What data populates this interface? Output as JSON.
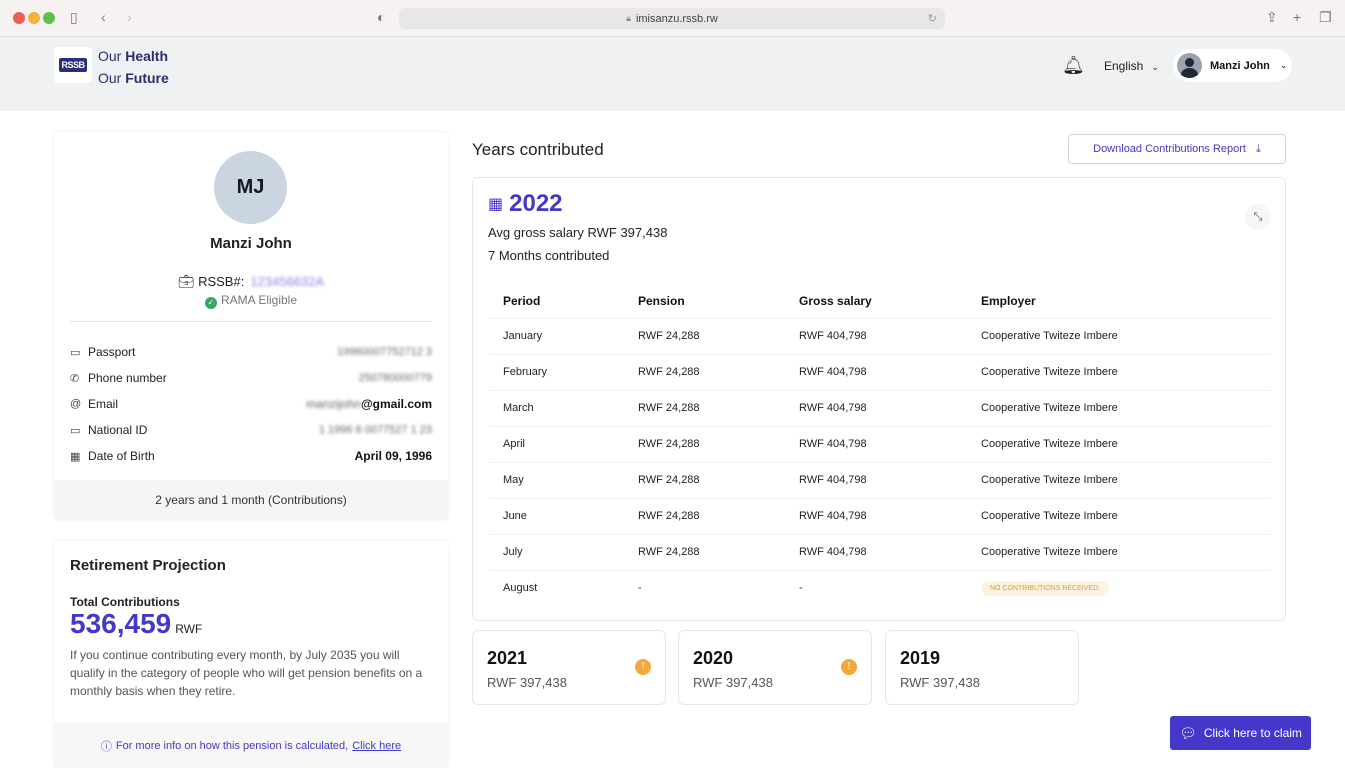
{
  "browser": {
    "url": "imisanzu.rssb.rw"
  },
  "header": {
    "logo_text": "RSSB",
    "tagline_line1_prefix": "Our",
    "tagline_line1_bold": "Health",
    "tagline_line2_prefix": "Our",
    "tagline_line2_bold": "Future",
    "language": "English",
    "user_name": "Manzi John"
  },
  "profile": {
    "initials": "MJ",
    "name": "Manzi John",
    "rssb_label": "RSSB#:",
    "rssb_number": "123456632A",
    "rama_status": "RAMA Eligible",
    "fields": [
      {
        "label": "Passport",
        "value": "19960007752712 3",
        "icon": "id-card-icon",
        "blurred": true
      },
      {
        "label": "Phone number",
        "value": "250780000779",
        "icon": "phone-icon",
        "blurred": true
      },
      {
        "label": "Email",
        "value_blur": "manzijohn",
        "value": "@gmail.com",
        "icon": "at-icon"
      },
      {
        "label": "National ID",
        "value": "1 1996 8 0077527 1 23",
        "icon": "id-card-icon",
        "blurred": true
      },
      {
        "label": "Date of Birth",
        "value": "April 09, 1996",
        "icon": "calendar-icon"
      }
    ],
    "contribution_duration": "2 years and 1 month (Contributions)"
  },
  "retirement": {
    "title": "Retirement Projection",
    "total_label": "Total Contributions",
    "total_value": "536,459",
    "currency": "RWF",
    "description": "If you continue contributing every month, by July 2035 you will qualify in the category of people who will get pension benefits on a monthly basis when they retire.",
    "info_text": "For more info on how this pension is calculated,",
    "info_link": "Click here"
  },
  "years": {
    "title": "Years contributed",
    "download_label": "Download Contributions Report",
    "current": {
      "year": "2022",
      "avg_salary": "Avg gross salary RWF 397,438",
      "months": "7 Months contributed",
      "columns": [
        "Period",
        "Pension",
        "Gross salary",
        "Employer"
      ],
      "rows": [
        [
          "January",
          "RWF 24,288",
          "RWF 404,798",
          "Cooperative Twiteze Imbere"
        ],
        [
          "February",
          "RWF 24,288",
          "RWF 404,798",
          "Cooperative Twiteze Imbere"
        ],
        [
          "March",
          "RWF 24,288",
          "RWF 404,798",
          "Cooperative Twiteze Imbere"
        ],
        [
          "April",
          "RWF 24,288",
          "RWF 404,798",
          "Cooperative Twiteze Imbere"
        ],
        [
          "May",
          "RWF 24,288",
          "RWF 404,798",
          "Cooperative Twiteze Imbere"
        ],
        [
          "June",
          "RWF 24,288",
          "RWF 404,798",
          "Cooperative Twiteze Imbere"
        ],
        [
          "July",
          "RWF 24,288",
          "RWF 404,798",
          "Cooperative Twiteze Imbere"
        ],
        [
          "August",
          "-",
          "-",
          "NO CONTRIBUTIONS RECEIVED."
        ]
      ]
    },
    "others": [
      {
        "year": "2021",
        "amount": "RWF 397,438",
        "warning": true
      },
      {
        "year": "2020",
        "amount": "RWF 397,438",
        "warning": true
      },
      {
        "year": "2019",
        "amount": "RWF 397,438",
        "warning": false
      }
    ]
  },
  "claim_button": "Click here to claim",
  "colors": {
    "accent": "#4338ca",
    "warning": "#f2a83b",
    "success": "#3aa760"
  }
}
